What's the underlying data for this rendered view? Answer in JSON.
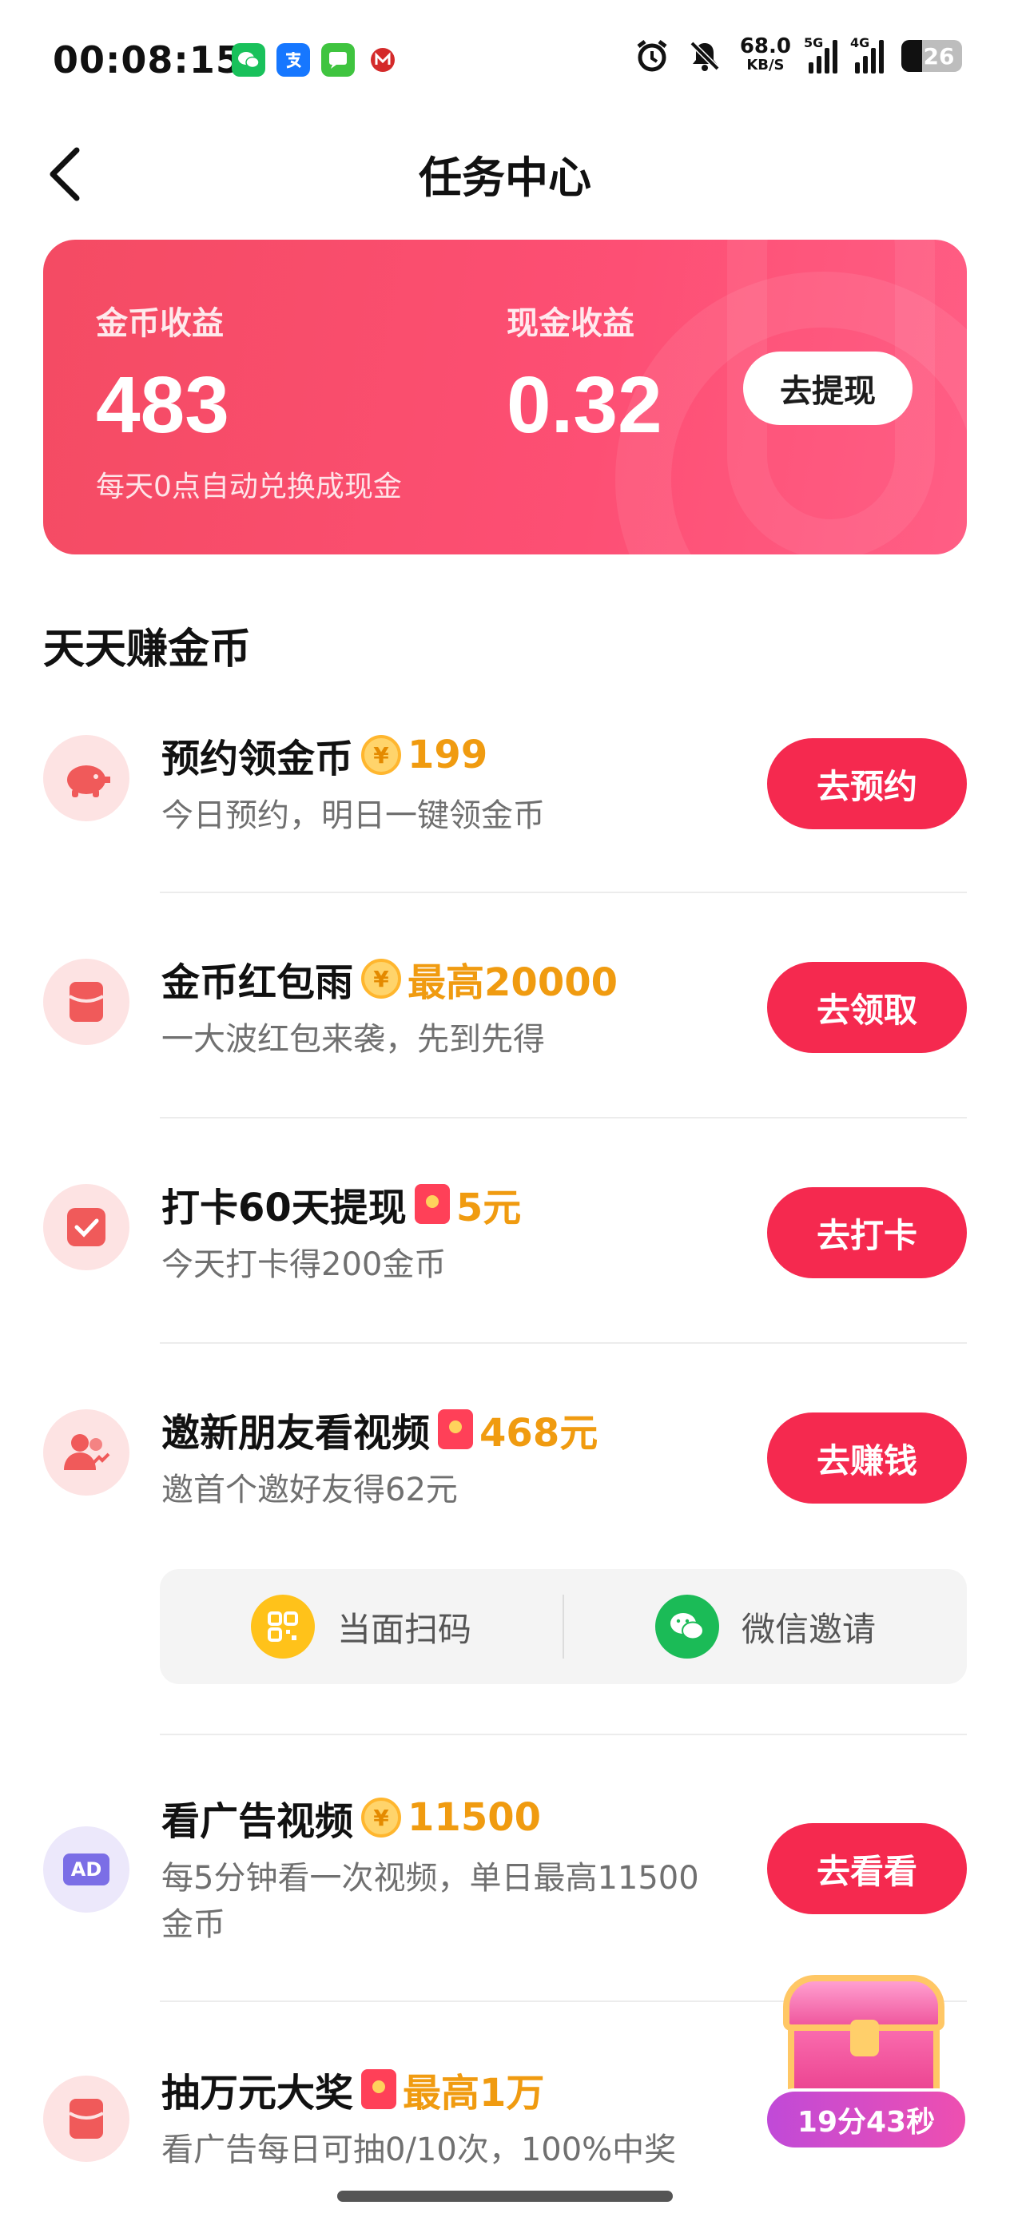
{
  "status_bar": {
    "time": "00:08:15",
    "network_speed": "68.0",
    "network_unit": "KB/S",
    "signal1_tag": "5G",
    "signal2_tag": "4G",
    "battery": "26"
  },
  "header": {
    "title": "任务中心"
  },
  "earnings": {
    "coin_label": "金币收益",
    "coin_value": "483",
    "cash_label": "现金收益",
    "cash_value": "0.32",
    "note": "每天0点自动兑换成现金",
    "withdraw_label": "去提现"
  },
  "section_title": "天天赚金币",
  "tasks": [
    {
      "title": "预约领金币",
      "reward_icon": "coin-icon",
      "reward": "199",
      "desc": "今日预约，明日一键领金币",
      "button": "去预约"
    },
    {
      "title": "金币红包雨",
      "reward_icon": "coin-icon",
      "reward": "最高20000",
      "desc": "一大波红包来袭，先到先得",
      "button": "去领取"
    },
    {
      "title": "打卡60天提现",
      "reward_icon": "red-packet-icon",
      "reward": "5元",
      "desc": "今天打卡得200金币",
      "button": "去打卡"
    },
    {
      "title": "邀新朋友看视频",
      "reward_icon": "red-packet-icon",
      "reward": "468元",
      "desc": "邀首个邀好友得62元",
      "button": "去赚钱"
    },
    {
      "title": "看广告视频",
      "reward_icon": "coin-icon",
      "reward": "11500",
      "desc_line1": "每5分钟看一次视频，单日最高11500",
      "desc_line2": "金币",
      "button": "去看看"
    },
    {
      "title": "抽万元大奖",
      "reward_icon": "red-packet-icon",
      "reward": "最高1万",
      "desc": "看广告每日可抽0/10次，100%中奖"
    }
  ],
  "invite_options": {
    "scan_label": "当面扫码",
    "wechat_label": "微信邀请"
  },
  "ad_icon_text": "AD",
  "coin_symbol": "¥",
  "treasure": {
    "timer": "19分43秒"
  },
  "colors": {
    "accent": "#f5294f",
    "card": "#f44b63",
    "reward": "#f09b10"
  }
}
